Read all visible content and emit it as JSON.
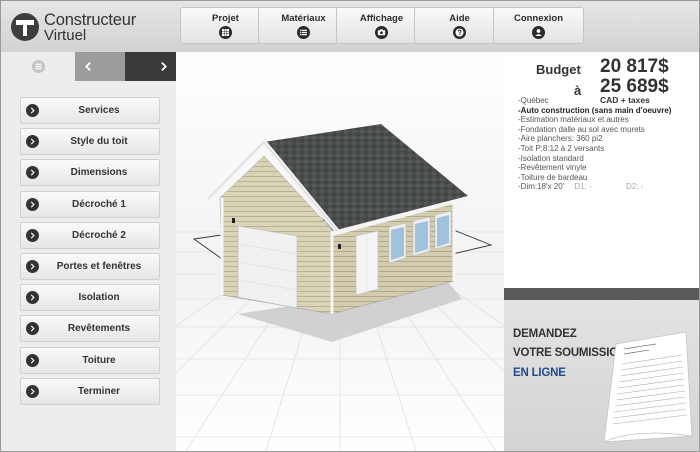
{
  "app": {
    "logo_line1": "Constructeur",
    "logo_line2": "Virtuel"
  },
  "menu": [
    {
      "label": "Projet",
      "icon": "grid-icon"
    },
    {
      "label": "Matériaux",
      "icon": "list-icon"
    },
    {
      "label": "Affichage",
      "icon": "camera-icon"
    },
    {
      "label": "Aide",
      "icon": "help-icon"
    },
    {
      "label": "Connexion",
      "icon": "user-icon"
    }
  ],
  "steps": [
    "Services",
    "Style du toit",
    "Dimensions",
    "Décroché 1",
    "Décroché 2",
    "Portes et fenêtres",
    "Isolation",
    "Revêtements",
    "Toiture",
    "Terminer"
  ],
  "budget": {
    "label": "Budget",
    "min": "20 817$",
    "to": "à",
    "max": "25 689$",
    "suffix": "CAD + taxes"
  },
  "summary": {
    "region": "-Québec",
    "service": "-Auto construction (sans main d'oeuvre)",
    "lines": [
      "-Estimation matériaux et autres",
      "-Fondation dalle au sol avec murets",
      "-Aire planchers: 360 pi2",
      "-Toit P:8:12   à 2 versants",
      "-Isolation standard",
      "-Revêtement vinyle",
      "-Toiture de bardeau"
    ],
    "dim_main": "-Dim:18'x 20'",
    "dim_d1": "D1: -",
    "dim_d2": "D2: -"
  },
  "promo": {
    "line1": "DEMANDEZ",
    "line2": "VOTRE SOUMISSION",
    "line3": "EN LIGNE"
  },
  "colors": {
    "accent_blue": "#1f4b8e",
    "dark": "#3a3a3a",
    "roof": "#4a4d4c",
    "siding": "#d6cfb3"
  }
}
